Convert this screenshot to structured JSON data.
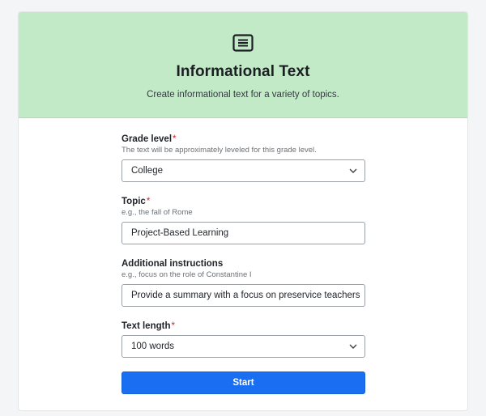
{
  "header": {
    "title": "Informational Text",
    "subtitle": "Create informational text for a variety of topics.",
    "icon": "text-document-icon",
    "background_color": "#c3eac7"
  },
  "form": {
    "grade_level": {
      "label": "Grade level",
      "required_mark": "*",
      "hint": "The text will be approximately leveled for this grade level.",
      "value": "College"
    },
    "topic": {
      "label": "Topic",
      "required_mark": "*",
      "hint": "e.g., the fall of Rome",
      "value": "Project-Based Learning"
    },
    "additional_instructions": {
      "label": "Additional instructions",
      "hint": "e.g., focus on the role of Constantine I",
      "value": "Provide a summary with a focus on preservice teachers"
    },
    "text_length": {
      "label": "Text length",
      "required_mark": "*",
      "value": "100 words"
    },
    "start_label": "Start",
    "accent_color": "#1a6ef2",
    "required_color": "#d0242b"
  }
}
